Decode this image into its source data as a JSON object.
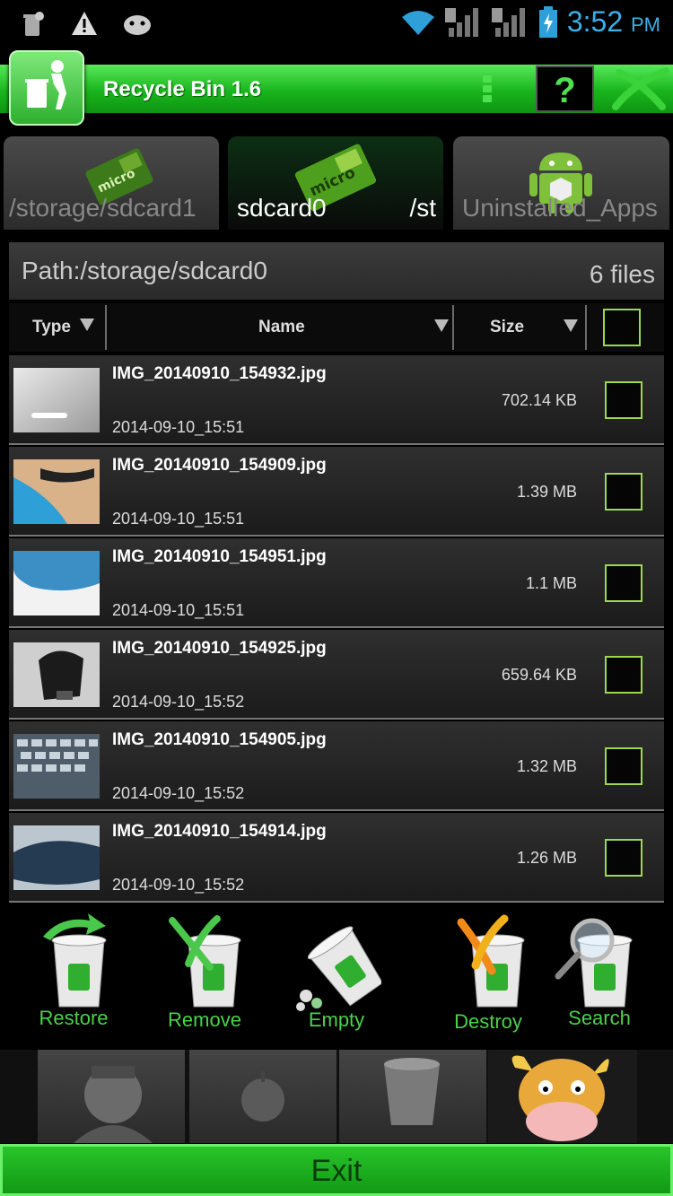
{
  "status_bar": {
    "time": "3:52",
    "ampm": "PM",
    "icons": [
      "recycle-notification-icon",
      "warning-icon",
      "android-debug-icon",
      "wifi-icon",
      "signal-1-icon",
      "signal-2-icon",
      "battery-charging-icon"
    ]
  },
  "app": {
    "title": "Recycle Bin 1.6",
    "help_label": "?"
  },
  "tabs": [
    {
      "label": "/storage/sdcard1",
      "icon": "microsd-icon",
      "active": false
    },
    {
      "label": "sdcard0",
      "sub": "/st",
      "icon": "microsd-icon",
      "active": true
    },
    {
      "label": "Uninstalled_Apps",
      "icon": "android-icon",
      "active": false
    }
  ],
  "path": {
    "label": "Path:/storage/sdcard0",
    "count": "6 files"
  },
  "columns": {
    "type": "Type",
    "name": "Name",
    "size": "Size"
  },
  "files": [
    {
      "name": "IMG_20140910_154932.jpg",
      "date": "2014-09-10_15:51",
      "size": "702.14 KB"
    },
    {
      "name": "IMG_20140910_154909.jpg",
      "date": "2014-09-10_15:51",
      "size": "1.39 MB"
    },
    {
      "name": "IMG_20140910_154951.jpg",
      "date": "2014-09-10_15:51",
      "size": "1.1 MB"
    },
    {
      "name": "IMG_20140910_154925.jpg",
      "date": "2014-09-10_15:52",
      "size": "659.64 KB"
    },
    {
      "name": "IMG_20140910_154905.jpg",
      "date": "2014-09-10_15:52",
      "size": "1.32 MB"
    },
    {
      "name": "IMG_20140910_154914.jpg",
      "date": "2014-09-10_15:52",
      "size": "1.26 MB"
    }
  ],
  "actions": {
    "restore": "Restore",
    "remove": "Remove",
    "empty": "Empty",
    "destroy": "Destroy",
    "search": "Search"
  },
  "exit_label": "Exit",
  "colors": {
    "accent_green": "#19b51d",
    "clock_blue": "#3ab0e8",
    "label_green": "#4ad24a"
  }
}
